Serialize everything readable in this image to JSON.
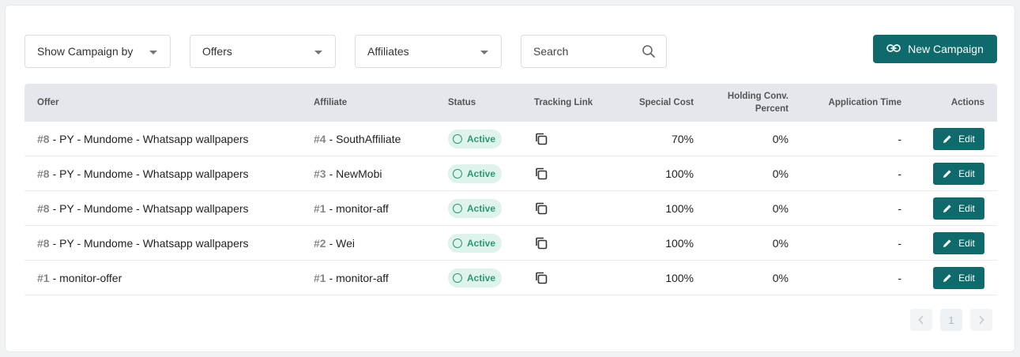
{
  "filters": {
    "campaign_by": "Show Campaign by",
    "offers": "Offers",
    "affiliates": "Affiliates",
    "search_placeholder": "Search"
  },
  "new_campaign_label": "New Campaign",
  "table": {
    "headers": {
      "offer": "Offer",
      "affiliate": "Affiliate",
      "status": "Status",
      "tracking_link": "Tracking Link",
      "special_cost": "Special Cost",
      "holding_line1": "Holding Conv.",
      "holding_line2": "Percent",
      "application_time": "Application Time",
      "actions": "Actions"
    },
    "rows": [
      {
        "offer_id": "#8",
        "offer_name": "- PY - Mundome - Whatsapp wallpapers",
        "aff_id": "#4",
        "aff_name": "- SouthAffiliate",
        "status": "Active",
        "special_cost": "70%",
        "holding": "0%",
        "app_time": "-",
        "edit": "Edit"
      },
      {
        "offer_id": "#8",
        "offer_name": "- PY - Mundome - Whatsapp wallpapers",
        "aff_id": "#3",
        "aff_name": "- NewMobi",
        "status": "Active",
        "special_cost": "100%",
        "holding": "0%",
        "app_time": "-",
        "edit": "Edit"
      },
      {
        "offer_id": "#8",
        "offer_name": "- PY - Mundome - Whatsapp wallpapers",
        "aff_id": "#1",
        "aff_name": "- monitor-aff",
        "status": "Active",
        "special_cost": "100%",
        "holding": "0%",
        "app_time": "-",
        "edit": "Edit"
      },
      {
        "offer_id": "#8",
        "offer_name": "- PY - Mundome - Whatsapp wallpapers",
        "aff_id": "#2",
        "aff_name": "- Wei",
        "status": "Active",
        "special_cost": "100%",
        "holding": "0%",
        "app_time": "-",
        "edit": "Edit"
      },
      {
        "offer_id": "#1",
        "offer_name": "- monitor-offer",
        "aff_id": "#1",
        "aff_name": "- monitor-aff",
        "status": "Active",
        "special_cost": "100%",
        "holding": "0%",
        "app_time": "-",
        "edit": "Edit"
      }
    ]
  },
  "pagination": {
    "current_page": "1"
  },
  "colors": {
    "accent": "#0f6b6b",
    "status_bg": "#def3ec",
    "status_text": "#2a9a70",
    "header_bg": "#e4e8ec"
  }
}
